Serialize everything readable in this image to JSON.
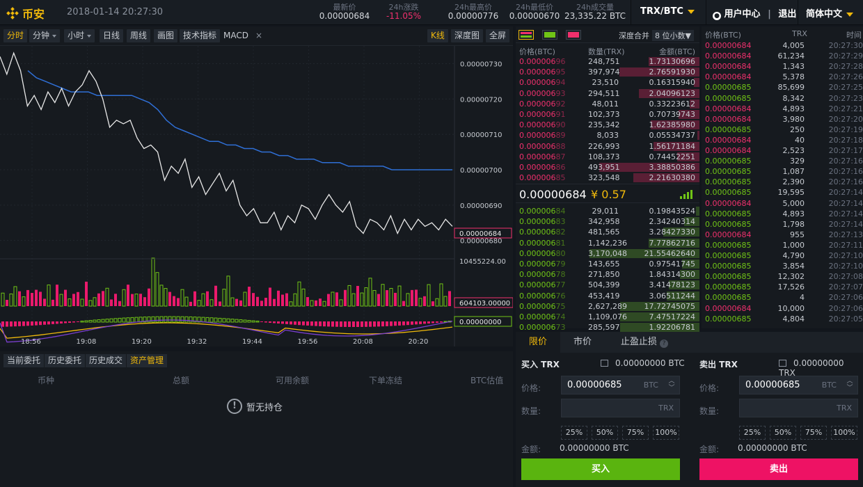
{
  "header": {
    "brand": "币安",
    "datetime": "2018-01-14 20:27:30",
    "stats": [
      {
        "label": "最新价",
        "value": "0.00000684"
      },
      {
        "label": "24h涨跌",
        "value": "-11.05%"
      },
      {
        "label": "24h最高价",
        "value": "0.00000776"
      },
      {
        "label": "24h最低价",
        "value": "0.00000670"
      },
      {
        "label": "24h成交量",
        "value": "23,335.22 BTC"
      }
    ],
    "pair": "TRX/BTC",
    "user_center": "用户中心",
    "logout": "退出",
    "language": "简体中文"
  },
  "chart_toolbar": {
    "tabs": [
      "分时",
      "分钟",
      "小时",
      "日线",
      "周线",
      "画图",
      "技术指标",
      "MACD"
    ],
    "close": "×",
    "right": [
      "K线",
      "深度图",
      "全屏"
    ]
  },
  "chart_data": {
    "type": "line",
    "price_axis": [
      "0.00000730",
      "0.00000720",
      "0.00000710",
      "0.00000700",
      "0.00000690",
      "0.00000680"
    ],
    "current_price_tag": "0.00000684",
    "volume_max_label": "10455224.00",
    "volume_current_tag": "604103.00000",
    "macd_tag": "0.00000000",
    "time_axis": [
      "18:56",
      "19:08",
      "19:20",
      "19:32",
      "19:44",
      "19:56",
      "20:08",
      "20:20"
    ],
    "price_series": [
      7.32e-06,
      7.27e-06,
      7.33e-06,
      7.28e-06,
      7.18e-06,
      7.21e-06,
      7.17e-06,
      7.22e-06,
      7.19e-06,
      7.23e-06,
      7.18e-06,
      7.22e-06,
      7.24e-06,
      7.28e-06,
      7.25e-06,
      7.2e-06,
      7.12e-06,
      7.14e-06,
      7.13e-06,
      7.14e-06,
      7.09e-06,
      7.06e-06,
      7.07e-06,
      7.05e-06,
      6.97e-06,
      7.01e-06,
      6.99e-06,
      7.03e-06,
      6.95e-06,
      6.98e-06,
      6.93e-06,
      6.96e-06,
      6.99e-06,
      6.94e-06,
      6.97e-06,
      6.9e-06,
      6.87e-06,
      6.89e-06,
      6.85e-06,
      6.85e-06,
      6.88e-06,
      6.83e-06,
      6.87e-06,
      6.85e-06,
      6.9e-06,
      6.89e-06,
      6.86e-06,
      6.9e-06,
      6.93e-06,
      6.9e-06,
      6.88e-06,
      6.91e-06,
      6.84e-06,
      6.82e-06,
      6.86e-06,
      6.85e-06,
      6.83e-06,
      6.87e-06,
      6.82e-06,
      6.86e-06,
      6.83e-06,
      6.86e-06,
      6.84e-06,
      6.85e-06,
      6.83e-06,
      6.86e-06,
      6.84e-06
    ],
    "ma_series": [
      7.28e-06,
      7.26e-06,
      7.25e-06,
      7.24e-06,
      7.23e-06,
      7.22e-06,
      7.22e-06,
      7.22e-06,
      7.21e-06,
      7.21e-06,
      7.21e-06,
      7.21e-06,
      7.21e-06,
      7.2e-06,
      7.19e-06,
      7.17e-06,
      7.14e-06,
      7.12e-06,
      7.11e-06,
      7.1e-06,
      7.09e-06,
      7.08e-06,
      7.08e-06,
      7.07e-06,
      7.07e-06,
      7.06e-06,
      7.06e-06,
      7.05e-06,
      7.05e-06,
      7.04e-06,
      7.04e-06,
      7.03e-06,
      7.03e-06,
      7.03e-06,
      7.02e-06,
      7.02e-06,
      7.02e-06,
      7.01e-06,
      7.01e-06,
      7.01e-06,
      7.01e-06,
      7.01e-06,
      7e-06,
      7e-06,
      7e-06,
      7e-06,
      7e-06,
      7e-06,
      7e-06,
      7e-06
    ]
  },
  "orders_panel": {
    "tabs": [
      "当前委托",
      "历史委托",
      "历史成交",
      "资产管理"
    ],
    "columns": [
      "币种",
      "总额",
      "可用余额",
      "下单冻结",
      "BTC估值"
    ],
    "empty": "暂无持仓"
  },
  "orderbook": {
    "depth_label": "深度合并",
    "depth_value": "8 位小数",
    "columns": [
      "价格(BTC)",
      "数量(TRX)",
      "金额(BTC)"
    ],
    "asks": [
      {
        "price": "0.00000696",
        "qty": "248,751",
        "amount": "1.73130696",
        "w": 0.46
      },
      {
        "price": "0.00000695",
        "qty": "397,974",
        "amount": "2.76591930",
        "w": 0.73
      },
      {
        "price": "0.00000694",
        "qty": "23,510",
        "amount": "0.16315940",
        "w": 0.05
      },
      {
        "price": "0.00000693",
        "qty": "294,511",
        "amount": "2.04096123",
        "w": 0.55
      },
      {
        "price": "0.00000692",
        "qty": "48,011",
        "amount": "0.33223612",
        "w": 0.09
      },
      {
        "price": "0.00000691",
        "qty": "102,373",
        "amount": "0.70739743",
        "w": 0.19
      },
      {
        "price": "0.00000690",
        "qty": "235,342",
        "amount": "1.62385980",
        "w": 0.44
      },
      {
        "price": "0.00000689",
        "qty": "8,033",
        "amount": "0.05534737",
        "w": 0.02
      },
      {
        "price": "0.00000688",
        "qty": "226,993",
        "amount": "1.56171184",
        "w": 0.42
      },
      {
        "price": "0.00000687",
        "qty": "108,373",
        "amount": "0.74452251",
        "w": 0.2
      },
      {
        "price": "0.00000686",
        "qty": "493,951",
        "amount": "3.38850386",
        "w": 0.91
      },
      {
        "price": "0.00000685",
        "qty": "323,548",
        "amount": "2.21630380",
        "w": 0.6
      }
    ],
    "last_price": "0.00000684",
    "last_cny": "¥ 0.57",
    "bids": [
      {
        "price": "0.00000684",
        "qty": "29,011",
        "amount": "0.19843524",
        "w": 0.03
      },
      {
        "price": "0.00000683",
        "qty": "342,958",
        "amount": "2.34240314",
        "w": 0.14
      },
      {
        "price": "0.00000682",
        "qty": "481,565",
        "amount": "3.28427330",
        "w": 0.33
      },
      {
        "price": "0.00000681",
        "qty": "1,142,236",
        "amount": "7.77862716",
        "w": 0.46
      },
      {
        "price": "0.00000680",
        "qty": "3,170,048",
        "amount": "21.55462640",
        "w": 1.0
      },
      {
        "price": "0.00000679",
        "qty": "143,655",
        "amount": "0.97541745",
        "w": 0.16
      },
      {
        "price": "0.00000678",
        "qty": "271,850",
        "amount": "1.84314300",
        "w": 0.18
      },
      {
        "price": "0.00000677",
        "qty": "504,399",
        "amount": "3.41478123",
        "w": 0.28
      },
      {
        "price": "0.00000676",
        "qty": "453,419",
        "amount": "3.06511244",
        "w": 0.3
      },
      {
        "price": "0.00000675",
        "qty": "2,627,289",
        "amount": "17.72745075",
        "w": 0.72
      },
      {
        "price": "0.00000674",
        "qty": "1,109,076",
        "amount": "7.47517224",
        "w": 0.72
      },
      {
        "price": "0.00000673",
        "qty": "285,597",
        "amount": "1.92206781",
        "w": 0.72
      }
    ]
  },
  "trades": {
    "columns": [
      "价格(BTC)",
      "TRX",
      "时间"
    ],
    "rows": [
      {
        "price": "0.00000684",
        "qty": "4,005",
        "time": "20:27:30",
        "side": "sell"
      },
      {
        "price": "0.00000684",
        "qty": "61,234",
        "time": "20:27:29",
        "side": "sell"
      },
      {
        "price": "0.00000684",
        "qty": "1,343",
        "time": "20:27:28",
        "side": "sell"
      },
      {
        "price": "0.00000684",
        "qty": "5,378",
        "time": "20:27:26",
        "side": "sell"
      },
      {
        "price": "0.00000685",
        "qty": "85,699",
        "time": "20:27:25",
        "side": "buy"
      },
      {
        "price": "0.00000685",
        "qty": "8,342",
        "time": "20:27:23",
        "side": "buy"
      },
      {
        "price": "0.00000684",
        "qty": "4,893",
        "time": "20:27:21",
        "side": "sell"
      },
      {
        "price": "0.00000684",
        "qty": "3,980",
        "time": "20:27:20",
        "side": "sell"
      },
      {
        "price": "0.00000685",
        "qty": "250",
        "time": "20:27:19",
        "side": "buy"
      },
      {
        "price": "0.00000684",
        "qty": "40",
        "time": "20:27:18",
        "side": "sell"
      },
      {
        "price": "0.00000684",
        "qty": "2,523",
        "time": "20:27:17",
        "side": "sell"
      },
      {
        "price": "0.00000685",
        "qty": "329",
        "time": "20:27:16",
        "side": "buy"
      },
      {
        "price": "0.00000685",
        "qty": "1,087",
        "time": "20:27:16",
        "side": "buy"
      },
      {
        "price": "0.00000685",
        "qty": "2,390",
        "time": "20:27:16",
        "side": "buy"
      },
      {
        "price": "0.00000685",
        "qty": "19,595",
        "time": "20:27:14",
        "side": "buy"
      },
      {
        "price": "0.00000684",
        "qty": "5,000",
        "time": "20:27:14",
        "side": "sell"
      },
      {
        "price": "0.00000685",
        "qty": "4,893",
        "time": "20:27:14",
        "side": "buy"
      },
      {
        "price": "0.00000685",
        "qty": "1,798",
        "time": "20:27:14",
        "side": "buy"
      },
      {
        "price": "0.00000684",
        "qty": "955",
        "time": "20:27:13",
        "side": "sell"
      },
      {
        "price": "0.00000685",
        "qty": "1,000",
        "time": "20:27:11",
        "side": "buy"
      },
      {
        "price": "0.00000685",
        "qty": "4,790",
        "time": "20:27:10",
        "side": "buy"
      },
      {
        "price": "0.00000685",
        "qty": "3,854",
        "time": "20:27:10",
        "side": "buy"
      },
      {
        "price": "0.00000685",
        "qty": "12,302",
        "time": "20:27:08",
        "side": "buy"
      },
      {
        "price": "0.00000685",
        "qty": "17,526",
        "time": "20:27:07",
        "side": "buy"
      },
      {
        "price": "0.00000685",
        "qty": "4",
        "time": "20:27:06",
        "side": "buy"
      },
      {
        "price": "0.00000684",
        "qty": "10,000",
        "time": "20:27:06",
        "side": "sell"
      },
      {
        "price": "0.00000685",
        "qty": "4,804",
        "time": "20:27:05",
        "side": "buy"
      }
    ]
  },
  "trade_form": {
    "tabs": [
      "限价",
      "市价",
      "止盈止损"
    ],
    "buy": {
      "title": "买入 TRX",
      "balance": "0.00000000 BTC",
      "price_label": "价格:",
      "price": "0.00000685",
      "price_unit": "BTC",
      "qty_label": "数量:",
      "qty_unit": "TRX",
      "amount_label": "金额:",
      "amount": "0.00000000 BTC",
      "button": "买入"
    },
    "sell": {
      "title": "卖出 TRX",
      "balance": "0.00000000 TRX",
      "price_label": "价格:",
      "price": "0.00000685",
      "price_unit": "BTC",
      "qty_label": "数量:",
      "qty_unit": "TRX",
      "amount_label": "金额:",
      "amount": "0.00000000 BTC",
      "button": "卖出"
    },
    "percents": [
      "25%",
      "50%",
      "75%",
      "100%"
    ]
  },
  "colors": {
    "accent": "#f0b90b",
    "red": "#f0306d",
    "green": "#70c416",
    "buy_button": "#5ab40f",
    "sell_button": "#ee1264"
  }
}
